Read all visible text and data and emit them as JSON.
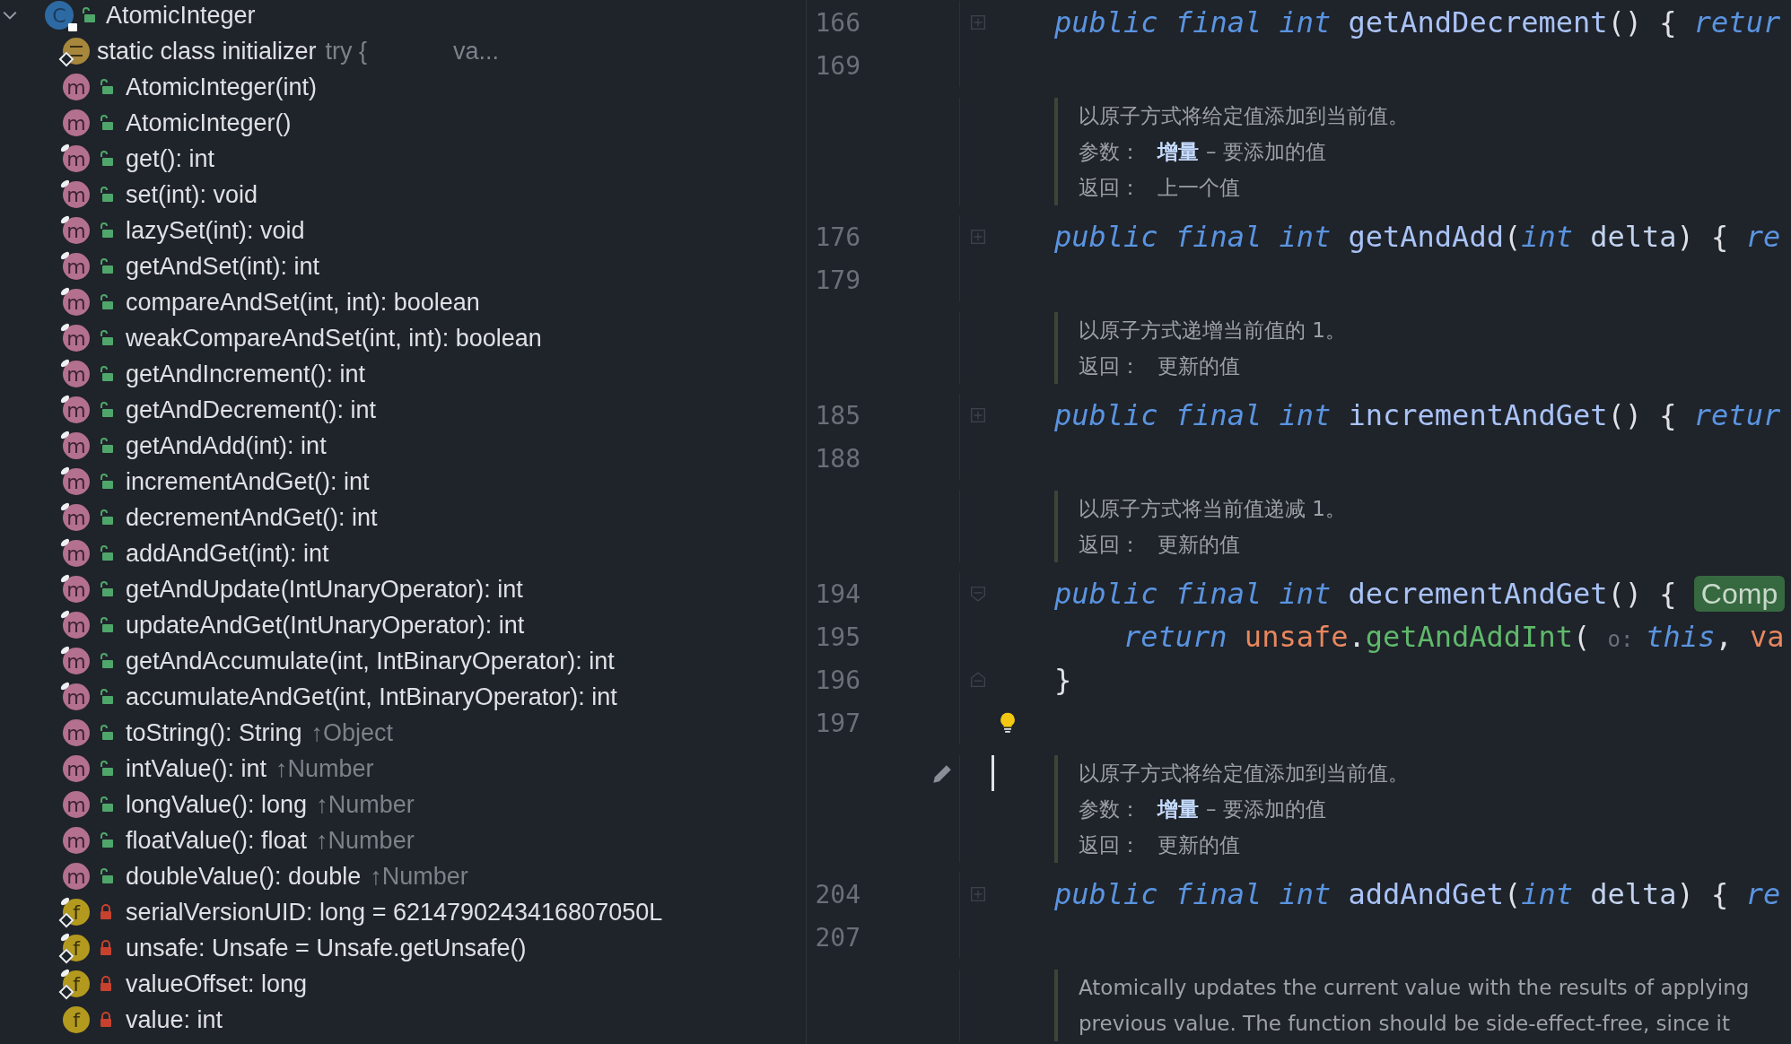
{
  "structure": {
    "root": {
      "label": "AtomicInteger",
      "icon": "C",
      "expanded": true,
      "public": true
    },
    "children": [
      {
        "kind": "initializer",
        "label": "static class initializer",
        "hint": "try {",
        "hint2": "va...",
        "static": true
      },
      {
        "kind": "method",
        "icon": "m",
        "label": "AtomicInteger(int)",
        "public": true,
        "final": false
      },
      {
        "kind": "method",
        "icon": "m",
        "label": "AtomicInteger()",
        "public": true,
        "final": false
      },
      {
        "kind": "method",
        "icon": "m",
        "label": "get(): int",
        "public": true,
        "final": true
      },
      {
        "kind": "method",
        "icon": "m",
        "label": "set(int): void",
        "public": true,
        "final": true
      },
      {
        "kind": "method",
        "icon": "m",
        "label": "lazySet(int): void",
        "public": true,
        "final": true
      },
      {
        "kind": "method",
        "icon": "m",
        "label": "getAndSet(int): int",
        "public": true,
        "final": true
      },
      {
        "kind": "method",
        "icon": "m",
        "label": "compareAndSet(int, int): boolean",
        "public": true,
        "final": true
      },
      {
        "kind": "method",
        "icon": "m",
        "label": "weakCompareAndSet(int, int): boolean",
        "public": true,
        "final": true
      },
      {
        "kind": "method",
        "icon": "m",
        "label": "getAndIncrement(): int",
        "public": true,
        "final": true
      },
      {
        "kind": "method",
        "icon": "m",
        "label": "getAndDecrement(): int",
        "public": true,
        "final": true
      },
      {
        "kind": "method",
        "icon": "m",
        "label": "getAndAdd(int): int",
        "public": true,
        "final": true
      },
      {
        "kind": "method",
        "icon": "m",
        "label": "incrementAndGet(): int",
        "public": true,
        "final": true
      },
      {
        "kind": "method",
        "icon": "m",
        "label": "decrementAndGet(): int",
        "public": true,
        "final": true
      },
      {
        "kind": "method",
        "icon": "m",
        "label": "addAndGet(int): int",
        "public": true,
        "final": true
      },
      {
        "kind": "method",
        "icon": "m",
        "label": "getAndUpdate(IntUnaryOperator): int",
        "public": true,
        "final": true
      },
      {
        "kind": "method",
        "icon": "m",
        "label": "updateAndGet(IntUnaryOperator): int",
        "public": true,
        "final": true
      },
      {
        "kind": "method",
        "icon": "m",
        "label": "getAndAccumulate(int, IntBinaryOperator): int",
        "public": true,
        "final": true
      },
      {
        "kind": "method",
        "icon": "m",
        "label": "accumulateAndGet(int, IntBinaryOperator): int",
        "public": true,
        "final": true
      },
      {
        "kind": "method",
        "icon": "m",
        "label": "toString(): String",
        "inherited": "↑Object",
        "public": true,
        "final": false
      },
      {
        "kind": "method",
        "icon": "m",
        "label": "intValue(): int",
        "inherited": "↑Number",
        "public": true,
        "final": false
      },
      {
        "kind": "method",
        "icon": "m",
        "label": "longValue(): long",
        "inherited": "↑Number",
        "public": true,
        "final": false
      },
      {
        "kind": "method",
        "icon": "m",
        "label": "floatValue(): float",
        "inherited": "↑Number",
        "public": true,
        "final": false
      },
      {
        "kind": "method",
        "icon": "m",
        "label": "doubleValue(): double",
        "inherited": "↑Number",
        "public": true,
        "final": false
      },
      {
        "kind": "field",
        "icon": "f",
        "label": "serialVersionUID: long = 6214790243416807050L",
        "public": false,
        "final": true,
        "static": true
      },
      {
        "kind": "field",
        "icon": "f",
        "label": "unsafe: Unsafe = Unsafe.getUnsafe()",
        "public": false,
        "final": true,
        "static": true
      },
      {
        "kind": "field",
        "icon": "f",
        "label": "valueOffset: long",
        "public": false,
        "final": true,
        "static": true
      },
      {
        "kind": "field",
        "icon": "f",
        "label": "value: int",
        "public": false,
        "final": false,
        "static": false
      }
    ]
  },
  "editor": {
    "rows": [
      {
        "kind": "code",
        "number": "166",
        "fold": {
          "kind": "collapsed"
        },
        "tokens": [
          {
            "kind": "keyword",
            "text": "public final int "
          },
          {
            "kind": "name",
            "text": "getAndDecrement"
          },
          {
            "kind": "plain",
            "text": "() { "
          },
          {
            "kind": "keyword",
            "text": "retur"
          }
        ]
      },
      {
        "kind": "code",
        "number": "169"
      },
      {
        "kind": "doc",
        "lines": [
          {
            "text": "以原子方式将给定值添加到当前值。"
          },
          {
            "label": "参数：",
            "param": "增量",
            "text": "– 要添加的值"
          },
          {
            "label": "返回：",
            "text": "上一个值"
          }
        ]
      },
      {
        "kind": "code",
        "number": "176",
        "fold": {
          "kind": "collapsed"
        },
        "tokens": [
          {
            "kind": "keyword",
            "text": "public final int "
          },
          {
            "kind": "name",
            "text": "getAndAdd"
          },
          {
            "kind": "plain",
            "text": "("
          },
          {
            "kind": "keyword",
            "text": "int "
          },
          {
            "kind": "param",
            "text": "delta"
          },
          {
            "kind": "plain",
            "text": ") { "
          },
          {
            "kind": "keyword",
            "text": "re"
          }
        ]
      },
      {
        "kind": "code",
        "number": "179"
      },
      {
        "kind": "doc",
        "lines": [
          {
            "text": "以原子方式递增当前值的 1。"
          },
          {
            "label": "返回：",
            "text": "更新的值"
          }
        ]
      },
      {
        "kind": "code",
        "number": "185",
        "fold": {
          "kind": "collapsed"
        },
        "tokens": [
          {
            "kind": "keyword",
            "text": "public final int "
          },
          {
            "kind": "name",
            "text": "incrementAndGet"
          },
          {
            "kind": "plain",
            "text": "() { "
          },
          {
            "kind": "keyword",
            "text": "retur"
          }
        ]
      },
      {
        "kind": "code",
        "number": "188"
      },
      {
        "kind": "doc",
        "lines": [
          {
            "text": "以原子方式将当前值递减 1。"
          },
          {
            "label": "返回：",
            "text": "更新的值"
          }
        ]
      },
      {
        "kind": "code",
        "number": "194",
        "fold": {
          "kind": "start"
        },
        "tokens": [
          {
            "kind": "keyword",
            "text": "public final int "
          },
          {
            "kind": "name",
            "text": "decrementAndGet"
          },
          {
            "kind": "plain",
            "text": "() { "
          },
          {
            "kind": "badge",
            "text": "Comp"
          }
        ]
      },
      {
        "kind": "code",
        "number": "195",
        "indented": true,
        "tokens": [
          {
            "kind": "keyword",
            "text": "return "
          },
          {
            "kind": "field",
            "text": "unsafe"
          },
          {
            "kind": "plain",
            "text": "."
          },
          {
            "kind": "call",
            "text": "getAndAddInt"
          },
          {
            "kind": "plain",
            "text": "( "
          },
          {
            "kind": "hint",
            "text": "o:"
          },
          {
            "kind": "keyword",
            "text": "this"
          },
          {
            "kind": "plain",
            "text": ", "
          },
          {
            "kind": "field",
            "text": "va"
          }
        ]
      },
      {
        "kind": "code",
        "number": "196",
        "fold": {
          "kind": "end"
        },
        "tokens": [
          {
            "kind": "plain",
            "text": "}"
          }
        ]
      },
      {
        "kind": "code",
        "number": "197",
        "bulb": true
      },
      {
        "kind": "doc",
        "editing": true,
        "lines": [
          {
            "text": "以原子方式将给定值添加到当前值。"
          },
          {
            "label": "参数：",
            "param": "增量",
            "text": "– 要添加的值"
          },
          {
            "label": "返回：",
            "text": "更新的值"
          }
        ]
      },
      {
        "kind": "code",
        "number": "204",
        "fold": {
          "kind": "collapsed"
        },
        "tokens": [
          {
            "kind": "keyword",
            "text": "public final int "
          },
          {
            "kind": "name",
            "text": "addAndGet"
          },
          {
            "kind": "plain",
            "text": "("
          },
          {
            "kind": "keyword",
            "text": "int "
          },
          {
            "kind": "param",
            "text": "delta"
          },
          {
            "kind": "plain",
            "text": ") { "
          },
          {
            "kind": "keyword",
            "text": "re"
          }
        ]
      },
      {
        "kind": "code",
        "number": "207"
      },
      {
        "kind": "doc",
        "lines": [
          {
            "text": "Atomically updates the current value with the results of applying"
          },
          {
            "text": "previous value. The function should be side-effect-free, since it"
          }
        ]
      }
    ]
  }
}
